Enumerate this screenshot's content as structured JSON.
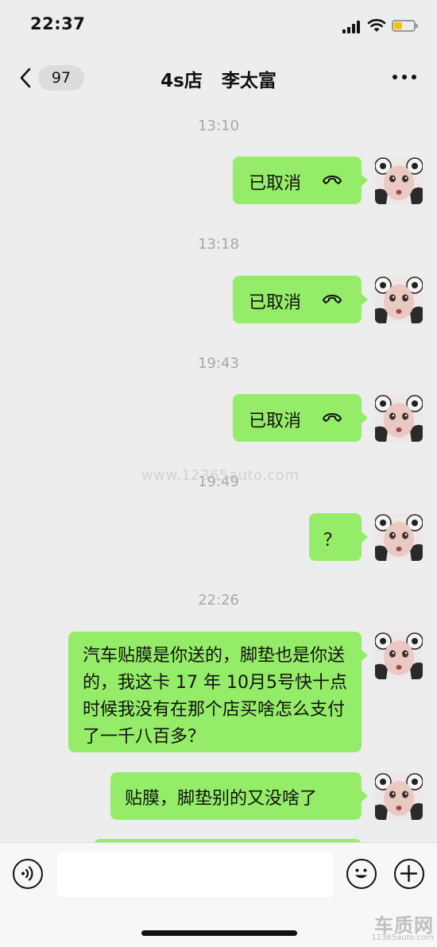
{
  "status_bar": {
    "time": "22:37",
    "battery_level": 0.4,
    "battery_color": "#f5c30b"
  },
  "nav": {
    "back_icon": "chevron-left-icon",
    "unread_count": "97",
    "title": "4s店   李太富",
    "more_icon": "more-dots-icon"
  },
  "messages": [
    {
      "time": "13:10",
      "text": "已取消",
      "type": "voice-call-cancelled",
      "icon": "phone-hangup-icon"
    },
    {
      "time": "13:18",
      "text": "已取消",
      "type": "voice-call-cancelled",
      "icon": "phone-hangup-icon"
    },
    {
      "time": "19:43",
      "text": "已取消",
      "type": "voice-call-cancelled",
      "icon": "phone-hangup-icon"
    },
    {
      "time": "19:49",
      "text": "？",
      "type": "text"
    },
    {
      "time": "22:26",
      "text": "汽车贴膜是你送的，脚垫也是你送的，我这卡 17 年 10月5号快十点时候我没有在那个店买啥怎么支付了一千八百多？",
      "type": "text"
    },
    {
      "text": "贴膜，脚垫别的又没啥了",
      "type": "text"
    }
  ],
  "watermark": "www.12365auto.com",
  "input_bar": {
    "voice_icon": "voice-input-icon",
    "text_value": "",
    "emoji_icon": "emoji-icon",
    "plus_icon": "plus-icon"
  },
  "corner_logo": {
    "name": "车质网",
    "url": "12365auto.com"
  },
  "colors": {
    "bubble_green": "#95ec69",
    "background": "#ededed"
  }
}
